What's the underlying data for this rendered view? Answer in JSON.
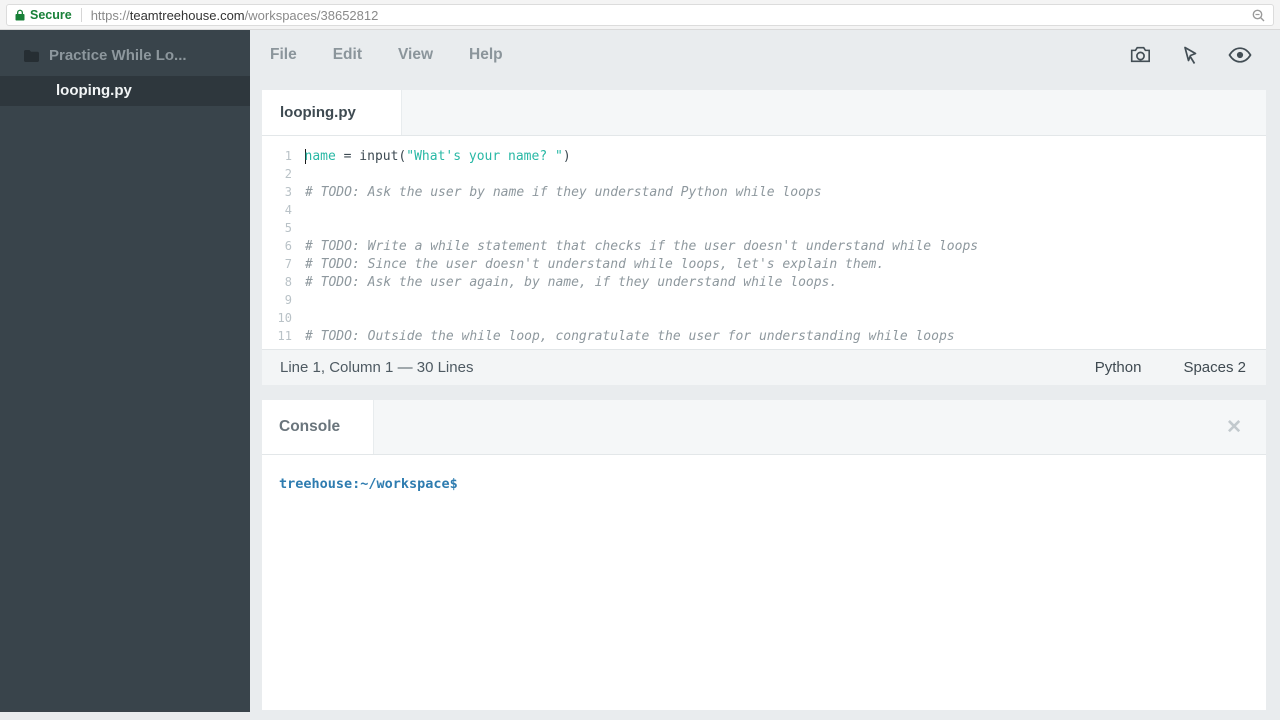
{
  "browser": {
    "secure_label": "Secure",
    "url_scheme": "https://",
    "url_host": "teamtreehouse.com",
    "url_path": "/workspaces/38652812"
  },
  "sidebar": {
    "project_name": "Practice While Lo...",
    "active_file": "looping.py"
  },
  "menu": {
    "items": [
      "File",
      "Edit",
      "View",
      "Help"
    ]
  },
  "editor": {
    "tab_label": "looping.py",
    "status_left": "Line 1, Column 1 — 30 Lines",
    "status_language": "Python",
    "status_indent": "Spaces  2",
    "colors": {
      "teal": "#29b8a5",
      "comment": "#8e989e",
      "plain": "#3d4a52"
    },
    "lines": [
      {
        "num": 1,
        "caret": true,
        "segments": [
          {
            "text": "name",
            "style": "teal"
          },
          {
            "text": " = input(",
            "style": "plain"
          },
          {
            "text": "\"What's your name? \"",
            "style": "teal"
          },
          {
            "text": ")",
            "style": "plain"
          }
        ]
      },
      {
        "num": 2,
        "segments": []
      },
      {
        "num": 3,
        "segments": [
          {
            "text": "# TODO: Ask the user by name if they understand Python while loops",
            "style": "comment"
          }
        ]
      },
      {
        "num": 4,
        "segments": []
      },
      {
        "num": 5,
        "segments": []
      },
      {
        "num": 6,
        "segments": [
          {
            "text": "# TODO: Write a while statement that checks if the user doesn't understand while loops",
            "style": "comment"
          }
        ]
      },
      {
        "num": 7,
        "segments": [
          {
            "text": "# TODO: Since the user doesn't understand while loops, let's explain them.",
            "style": "comment"
          }
        ]
      },
      {
        "num": 8,
        "segments": [
          {
            "text": "# TODO: Ask the user again, by name, if they understand while loops.",
            "style": "comment"
          }
        ]
      },
      {
        "num": 9,
        "segments": []
      },
      {
        "num": 10,
        "segments": []
      },
      {
        "num": 11,
        "segments": [
          {
            "text": "# TODO: Outside the while loop, congratulate the user for understanding while loops",
            "style": "comment"
          }
        ]
      }
    ]
  },
  "console": {
    "tab_label": "Console",
    "close_glyph": "✕",
    "prompt": "treehouse:~/workspace$"
  }
}
